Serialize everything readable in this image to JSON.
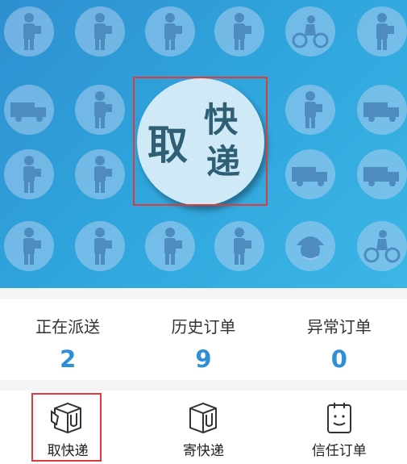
{
  "banner": {
    "hero_chars": [
      "取",
      "快",
      "递"
    ],
    "tile_icons": [
      "delivery-person-icon",
      "delivery-person-icon",
      "delivery-person-icon",
      "delivery-person-icon",
      "scooter-courier-icon",
      "delivery-person-icon",
      "truck-icon",
      "delivery-person-icon",
      "delivery-person-icon",
      "delivery-person-icon",
      "box-icon",
      "truck-icon",
      "running-courier-icon",
      "delivery-person-icon",
      "delivery-person-icon",
      "delivery-person-icon",
      "truck-front-icon",
      "hand-truck-icon",
      "delivery-person-icon",
      "delivery-person-icon",
      "walking-courier-icon",
      "delivery-person-icon",
      "courier-face-icon",
      "bicycle-courier-icon"
    ],
    "colors": {
      "top": "#2f8fd0",
      "bottom": "#3bb6e6",
      "tile": "#aacdf0"
    }
  },
  "stats": [
    {
      "label": "正在派送",
      "value": "2"
    },
    {
      "label": "历史订单",
      "value": "9"
    },
    {
      "label": "异常订单",
      "value": "0"
    }
  ],
  "actions": [
    {
      "label": "取快递",
      "icon": "pickup-package-icon"
    },
    {
      "label": "寄快递",
      "icon": "send-package-icon"
    },
    {
      "label": "信任订单",
      "icon": "trusted-order-icon"
    }
  ],
  "colors": {
    "accent": "#2e8fd6",
    "highlight": "#e03a3a"
  }
}
